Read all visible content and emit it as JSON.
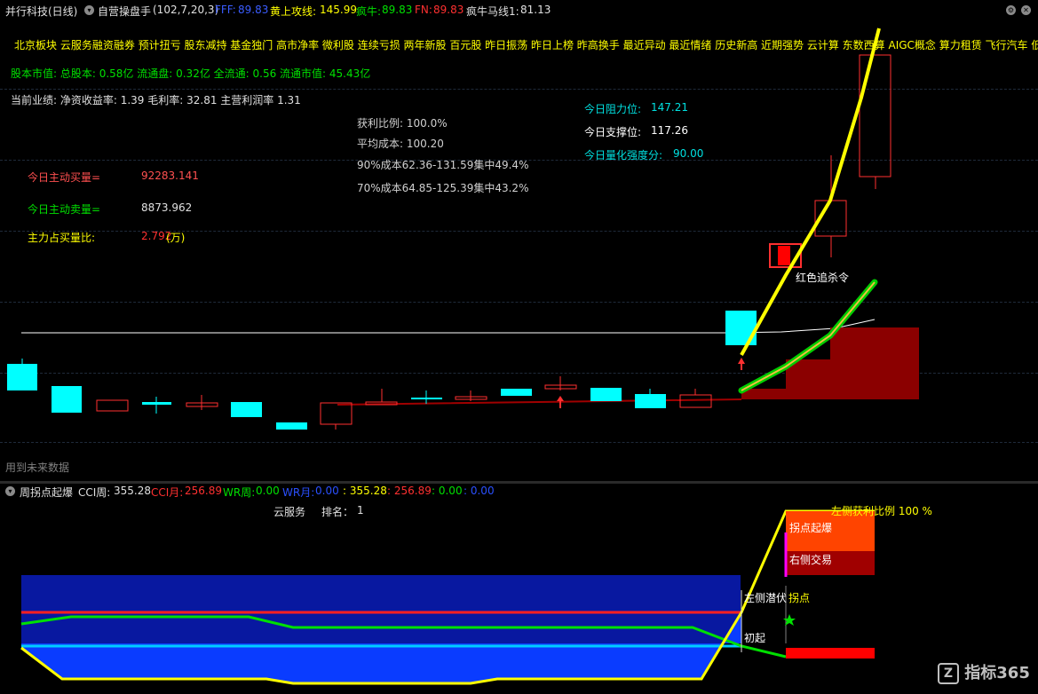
{
  "header": {
    "stock_name": "并行科技",
    "period": "(日线)",
    "indicator_name": "自营操盘手",
    "params": "(102,7,20,3)",
    "fff_label": "FFF:",
    "fff_value": "89.83",
    "yellow_line_label": "黄上攻线:",
    "yellow_line_value": "145.99",
    "crazy_bull_label": "疯牛:",
    "crazy_bull_value": "89.83",
    "fn_label": "FN:",
    "fn_value": "89.83",
    "horse_line_label": "疯牛马线1:",
    "horse_line_value": "81.13"
  },
  "concepts": "北京板块  云服务融资融券  预计扭亏  股东减持  基金独门  高市净率  微利股  连续亏损  两年新股  百元股  昨日振荡  昨日上榜  昨高换手  最近异动  最近情绪  历史新高  近期强势   云计算  东数西算  AIGC概念  算力租赁  飞行汽车  低空",
  "info": {
    "market_cap": "股本市值: 总股本: 0.58亿 流通盘: 0.32亿 全流通: 0.56 流通市值: 45.43亿",
    "performance": "当前业绩:  净资收益率: 1.39 毛利率: 32.81 主营利润率 1.31"
  },
  "chip": {
    "profit_ratio": "获利比例: 100.0%",
    "avg_cost": "平均成本: 100.20",
    "cost90": "90%成本62.36-131.59集中49.4%",
    "cost70": "70%成本64.85-125.39集中43.2%"
  },
  "levels": {
    "resistance_label": "今日阻力位:",
    "resistance_value": "147.21",
    "support_label": "今日支撑位:",
    "support_value": "117.26",
    "strength_label": "今日量化强度分:",
    "strength_value": "90.00"
  },
  "flow": {
    "buy_label": "今日主动买量=",
    "buy_value": "92283.141",
    "sell_label": "今日主动卖量=",
    "sell_value": "8873.962",
    "ratio_label": "主力占买量比:",
    "ratio_value": "2.792",
    "ratio_unit": "(万)"
  },
  "annotations": {
    "red_chase": "红色追杀令",
    "future_data": "用到未来数据"
  },
  "sub": {
    "name": "周拐点起爆",
    "cci_week_label": "CCI周:",
    "cci_week_value": "355.28",
    "cci_month_label": "CCI月:",
    "cci_month_value": "256.89",
    "wr_week_label": "WR周:",
    "wr_week_value": "0.00",
    "wr_month_label": "WR月:",
    "wr_month_value": "0.00",
    "extra1": ": 355.28",
    "extra2": ": 256.89",
    "extra3": ": 0.00",
    "extra4": ": 0.00",
    "sector": "云服务",
    "rank_label": "排名：",
    "rank_value": "1",
    "left_profit": "左侧获利比例 100 %",
    "inflection_burst": "拐点起爆",
    "right_trade": "右侧交易",
    "left_ambush": "左侧潜伏",
    "inflection": "拐点",
    "initial": "初起"
  },
  "watermark": "指标365",
  "colors": {
    "up": "#ff3030",
    "down": "#00ffff",
    "yellow": "#ffff00",
    "green": "#00e000",
    "blue_fill": "#0a2fd6",
    "dark_red": "#8b0000"
  }
}
